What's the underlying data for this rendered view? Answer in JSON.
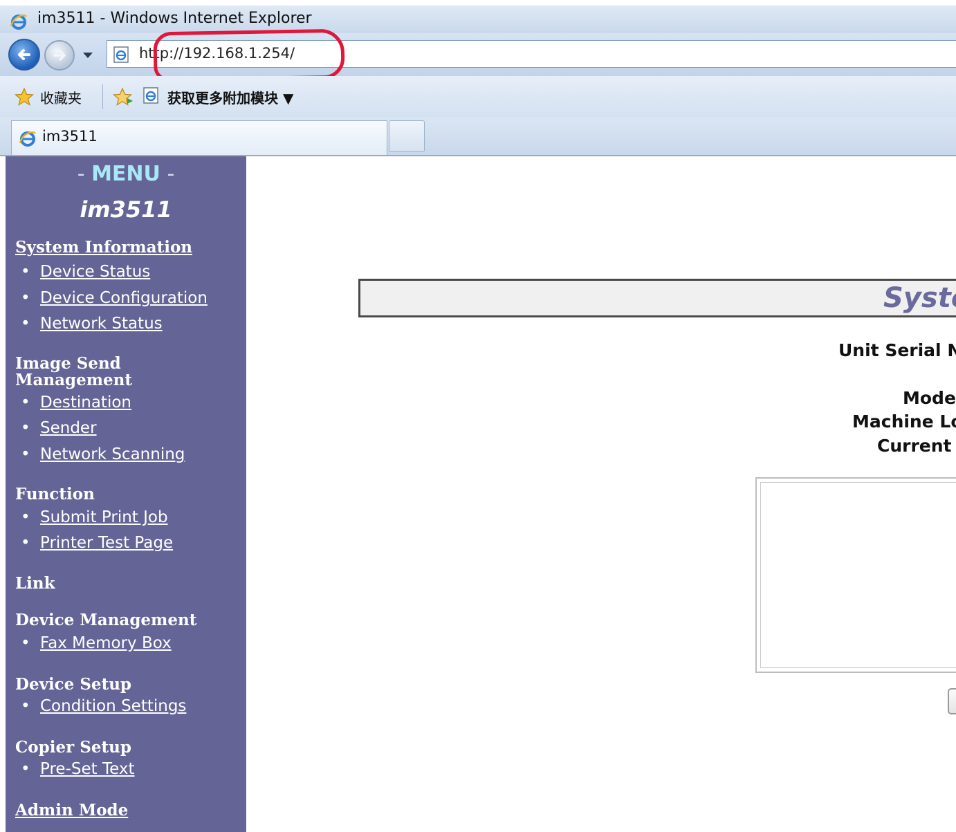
{
  "window": {
    "title": "im3511 - Windows Internet Explorer"
  },
  "navigation": {
    "url": "http://192.168.1.254/"
  },
  "favorites_bar": {
    "favorites_label": "收藏夹",
    "addons_label": "获取更多附加模块 ▼"
  },
  "tabs": [
    {
      "title": "im3511",
      "active": true
    }
  ],
  "colors": {
    "sidebar_bg": "#646496",
    "menu_heading": "#a9e8f5",
    "title_text": "#6a6a9c",
    "annotation_ring": "#e0173a"
  },
  "sidebar": {
    "menu_heading": "MENU",
    "device_name": "im3511",
    "sections": [
      {
        "title": "System Information",
        "is_link": true,
        "items": [
          "Device Status",
          "Device Configuration",
          "Network Status"
        ]
      },
      {
        "title": "Image Send Management",
        "is_link": false,
        "items": [
          "Destination",
          "Sender",
          "Network Scanning"
        ]
      },
      {
        "title": "Function",
        "is_link": false,
        "items": [
          "Submit Print Job",
          "Printer Test Page"
        ]
      },
      {
        "title": "Link",
        "is_link": false,
        "items": []
      },
      {
        "title": "Device Management",
        "is_link": false,
        "items": [
          "Fax Memory Box"
        ]
      },
      {
        "title": "Device Setup",
        "is_link": false,
        "items": [
          "Condition Settings"
        ]
      },
      {
        "title": "Copier Setup",
        "is_link": false,
        "items": [
          "Pre-Set Text"
        ]
      },
      {
        "title": "Admin Mode",
        "is_link": true,
        "items": []
      }
    ]
  },
  "main": {
    "page_title_visible": "Syste",
    "fields": {
      "unit_serial": "Unit Serial N",
      "model": "Model",
      "machine_location": "Machine Lo",
      "current": "Current"
    }
  }
}
